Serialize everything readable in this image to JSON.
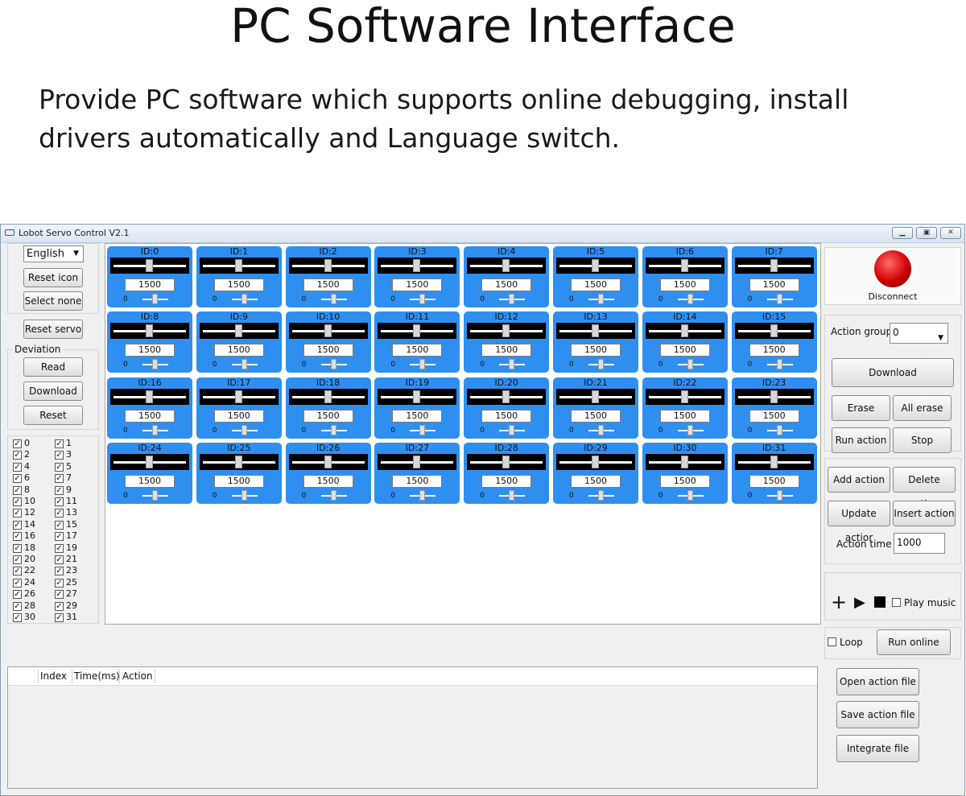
{
  "page": {
    "title": "PC Software Interface",
    "description": "Provide PC software which supports online debugging, install drivers automatically and Language switch."
  },
  "window": {
    "title": "Lobot Servo Control V2.1",
    "controls": [
      "minimize-icon",
      "maximize-icon",
      "close-icon"
    ]
  },
  "left": {
    "language": "English",
    "reset_icon": "Reset icon",
    "select_none": "Select none",
    "reset_servo": "Reset servo",
    "deviation_label": "Deviation",
    "read": "Read",
    "download": "Download",
    "reset": "Reset",
    "checkboxes": [
      "0",
      "1",
      "2",
      "3",
      "4",
      "5",
      "6",
      "7",
      "8",
      "9",
      "10",
      "11",
      "12",
      "13",
      "14",
      "15",
      "16",
      "17",
      "18",
      "19",
      "20",
      "21",
      "22",
      "23",
      "24",
      "25",
      "26",
      "27",
      "28",
      "29",
      "30",
      "31"
    ]
  },
  "servos": [
    {
      "id": "ID:0",
      "value": "1500",
      "dev": "0"
    },
    {
      "id": "ID:1",
      "value": "1500",
      "dev": "0"
    },
    {
      "id": "ID:2",
      "value": "1500",
      "dev": "0"
    },
    {
      "id": "ID:3",
      "value": "1500",
      "dev": "0"
    },
    {
      "id": "ID:4",
      "value": "1500",
      "dev": "0"
    },
    {
      "id": "ID:5",
      "value": "1500",
      "dev": "0"
    },
    {
      "id": "ID:6",
      "value": "1500",
      "dev": "0"
    },
    {
      "id": "ID:7",
      "value": "1500",
      "dev": "0"
    },
    {
      "id": "ID:8",
      "value": "1500",
      "dev": "0"
    },
    {
      "id": "ID:9",
      "value": "1500",
      "dev": "0"
    },
    {
      "id": "ID:10",
      "value": "1500",
      "dev": "0"
    },
    {
      "id": "ID:11",
      "value": "1500",
      "dev": "0"
    },
    {
      "id": "ID:12",
      "value": "1500",
      "dev": "0"
    },
    {
      "id": "ID:13",
      "value": "1500",
      "dev": "0"
    },
    {
      "id": "ID:14",
      "value": "1500",
      "dev": "0"
    },
    {
      "id": "ID:15",
      "value": "1500",
      "dev": "0"
    },
    {
      "id": "ID:16",
      "value": "1500",
      "dev": "0"
    },
    {
      "id": "ID:17",
      "value": "1500",
      "dev": "0"
    },
    {
      "id": "ID:18",
      "value": "1500",
      "dev": "0"
    },
    {
      "id": "ID:19",
      "value": "1500",
      "dev": "0"
    },
    {
      "id": "ID:20",
      "value": "1500",
      "dev": "0"
    },
    {
      "id": "ID:21",
      "value": "1500",
      "dev": "0"
    },
    {
      "id": "ID:22",
      "value": "1500",
      "dev": "0"
    },
    {
      "id": "ID:23",
      "value": "1500",
      "dev": "0"
    },
    {
      "id": "ID:24",
      "value": "1500",
      "dev": "0"
    },
    {
      "id": "ID:25",
      "value": "1500",
      "dev": "0"
    },
    {
      "id": "ID:26",
      "value": "1500",
      "dev": "0"
    },
    {
      "id": "ID:27",
      "value": "1500",
      "dev": "0"
    },
    {
      "id": "ID:28",
      "value": "1500",
      "dev": "0"
    },
    {
      "id": "ID:29",
      "value": "1500",
      "dev": "0"
    },
    {
      "id": "ID:30",
      "value": "1500",
      "dev": "0"
    },
    {
      "id": "ID:31",
      "value": "1500",
      "dev": "0"
    }
  ],
  "right": {
    "disconnect": "Disconnect",
    "status_color": "#d00000",
    "action_group_label": "Action group",
    "action_group_value": "0",
    "download": "Download",
    "erase_single": "Erase single",
    "all_erase": "All erase",
    "run_action": "Run action",
    "stop": "Stop",
    "add_action": "Add action",
    "delete_action": "Delete action",
    "update_action": "Update actior",
    "insert_action": "Insert action",
    "action_time_label": "Action time",
    "action_time_value": "1000",
    "play_music": "Play music",
    "loop": "Loop",
    "run_online": "Run online",
    "open_action_file": "Open action file",
    "save_action_file": "Save action file",
    "integrate_file": "Integrate file"
  },
  "table": {
    "columns": [
      "Index",
      "Time(ms)",
      "Action"
    ]
  },
  "colors": {
    "servo_panel": "#2f8ff0"
  }
}
